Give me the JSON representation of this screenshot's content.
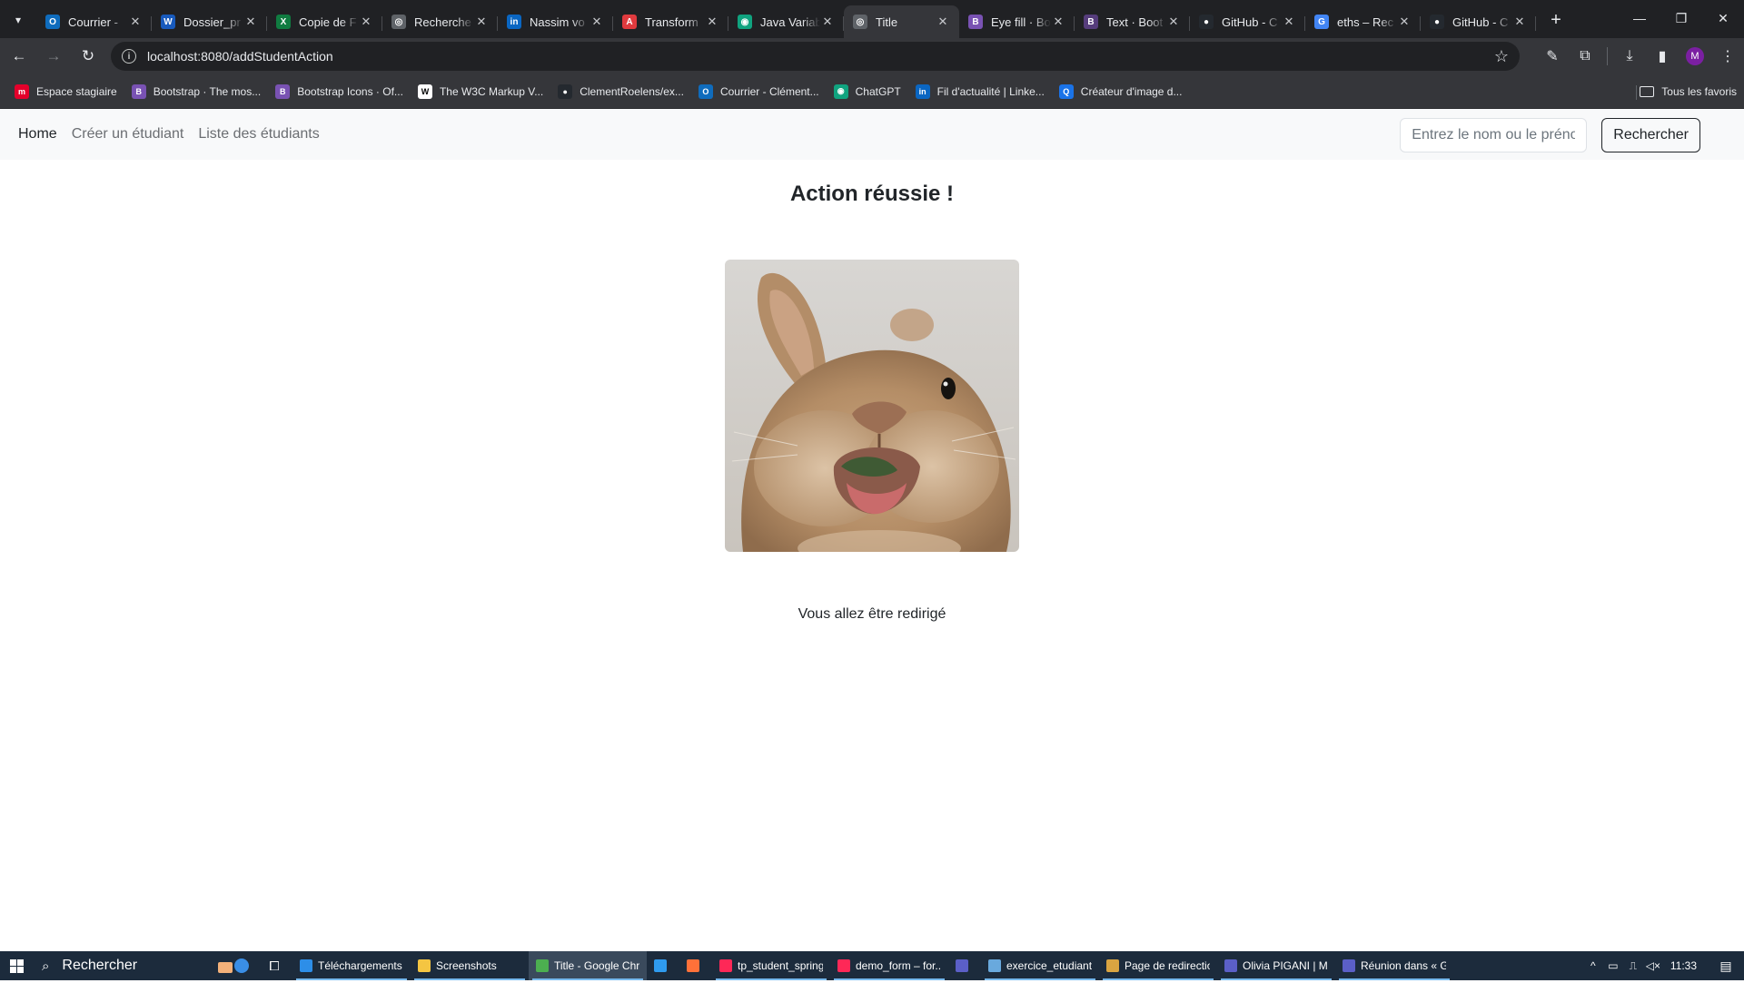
{
  "browser": {
    "tabs": [
      {
        "title": "Courrier - ",
        "icon": "outlook-icon",
        "color": "#0f6cbd",
        "glyph": "O"
      },
      {
        "title": "Dossier_pr",
        "icon": "word-icon",
        "color": "#185abd",
        "glyph": "W"
      },
      {
        "title": "Copie de F",
        "icon": "excel-icon",
        "color": "#107c41",
        "glyph": "X"
      },
      {
        "title": "Recherche",
        "icon": "globe-icon",
        "color": "#5f6368",
        "glyph": "◎"
      },
      {
        "title": "Nassim vo",
        "icon": "linkedin-icon",
        "color": "#0a66c2",
        "glyph": "in"
      },
      {
        "title": "Transform",
        "icon": "adobe-icon",
        "color": "#e03a3e",
        "glyph": "A"
      },
      {
        "title": "Java Variab",
        "icon": "chatgpt-icon",
        "color": "#10a37f",
        "glyph": "◉"
      },
      {
        "title": "Title",
        "icon": "globe-icon",
        "color": "#5f6368",
        "glyph": "◎",
        "active": true
      },
      {
        "title": "Eye fill · Bo",
        "icon": "bootstrap-icon",
        "color": "#7952b3",
        "glyph": "B"
      },
      {
        "title": "Text · Boot",
        "icon": "bootstrap-icon",
        "color": "#563d7c",
        "glyph": "B"
      },
      {
        "title": "GitHub - C",
        "icon": "github-icon",
        "color": "#24292f",
        "glyph": "●"
      },
      {
        "title": "eths – Rec",
        "icon": "google-icon",
        "color": "#4285f4",
        "glyph": "G"
      },
      {
        "title": "GitHub - C",
        "icon": "github-icon",
        "color": "#24292f",
        "glyph": "●"
      }
    ],
    "url": "localhost:8080/addStudentAction",
    "profile_initial": "M",
    "bookmarks": [
      {
        "label": "Espace stagiaire",
        "color": "#e4002b",
        "glyph": "m"
      },
      {
        "label": "Bootstrap · The mos...",
        "color": "#7952b3",
        "glyph": "B"
      },
      {
        "label": "Bootstrap Icons · Of...",
        "color": "#7952b3",
        "glyph": "B"
      },
      {
        "label": "The W3C Markup V...",
        "color": "#ffffff",
        "glyph": "W"
      },
      {
        "label": "ClementRoelens/ex...",
        "color": "#24292f",
        "glyph": "●"
      },
      {
        "label": "Courrier - Clément...",
        "color": "#0f6cbd",
        "glyph": "O"
      },
      {
        "label": "ChatGPT",
        "color": "#10a37f",
        "glyph": "◉"
      },
      {
        "label": "Fil d'actualité | Linke...",
        "color": "#0a66c2",
        "glyph": "in"
      },
      {
        "label": "Créateur d'image d...",
        "color": "#1a73e8",
        "glyph": "Q"
      }
    ],
    "all_bookmarks_label": "Tous les favoris"
  },
  "site": {
    "nav": {
      "home": "Home",
      "create": "Créer un étudiant",
      "list": "Liste des étudiants"
    },
    "search": {
      "placeholder": "Entrez le nom ou le prénom",
      "button": "Rechercher"
    },
    "headline": "Action réussie !",
    "message": "Vous allez être redirigé"
  },
  "taskbar": {
    "search_label": "Rechercher",
    "apps": [
      {
        "label": "Téléchargements",
        "icon": "download-folder-icon",
        "color": "#2d8ee8",
        "open": true
      },
      {
        "label": "Screenshots",
        "icon": "folder-icon",
        "color": "#f4c542",
        "open": true
      },
      {
        "label": "Title - Google Chr...",
        "icon": "chrome-icon",
        "color": "#4caf50",
        "open": true,
        "current": true
      },
      {
        "label": "",
        "icon": "vscode-icon",
        "color": "#2f9bef",
        "open": false
      },
      {
        "label": "",
        "icon": "firefox-icon",
        "color": "#ff7139",
        "open": false
      },
      {
        "label": "tp_student_spring ...",
        "icon": "intellij-icon",
        "color": "#fe2857",
        "open": true
      },
      {
        "label": "demo_form – for...",
        "icon": "intellij-icon",
        "color": "#fe2857",
        "open": true
      },
      {
        "label": "",
        "icon": "teams-icon",
        "color": "#5b5fc7",
        "open": false
      },
      {
        "label": "exercice_etudiant ...",
        "icon": "notepad-icon",
        "color": "#69a9dd",
        "open": true
      },
      {
        "label": "Page de redirectio...",
        "icon": "paint-icon",
        "color": "#d9a441",
        "open": true
      },
      {
        "label": "Olivia PIGANI | Mi...",
        "icon": "teams-icon",
        "color": "#5b5fc7",
        "open": true
      },
      {
        "label": "Réunion dans « G...",
        "icon": "teams-icon",
        "color": "#5b5fc7",
        "open": true
      }
    ],
    "clock": "11:33"
  }
}
